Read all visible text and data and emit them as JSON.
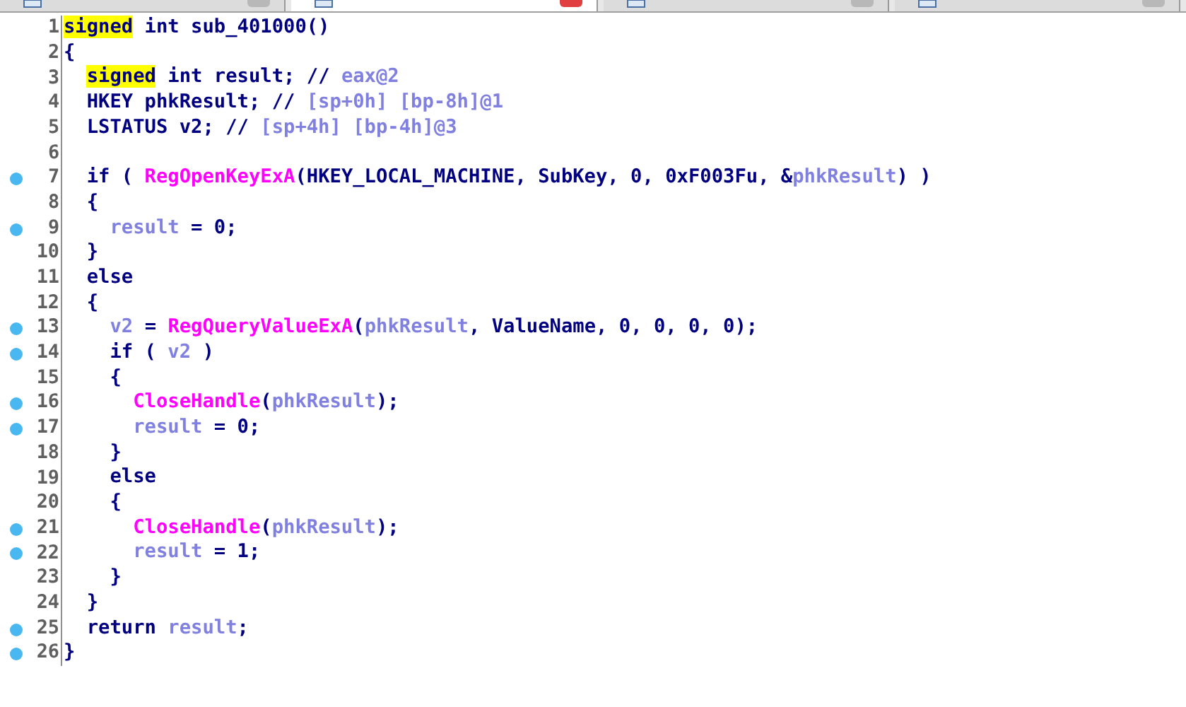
{
  "tabs": [
    {
      "selected": false
    },
    {
      "selected": true
    },
    {
      "selected": false
    },
    {
      "selected": false
    }
  ],
  "lines": [
    {
      "number": "1",
      "breakpoint": false,
      "cursor": true,
      "tokens": [
        {
          "kind": "highlight",
          "text": "signed"
        },
        {
          "kind": "plain",
          "text": " int sub_401000()"
        }
      ]
    },
    {
      "number": "2",
      "breakpoint": false,
      "cursor": false,
      "tokens": [
        {
          "kind": "plain",
          "text": "{"
        }
      ]
    },
    {
      "number": "3",
      "breakpoint": false,
      "cursor": false,
      "tokens": [
        {
          "kind": "highlight",
          "text": "  signed"
        },
        {
          "kind": "plain",
          "text": " int result; // "
        },
        {
          "kind": "local",
          "text": "eax@2"
        }
      ]
    },
    {
      "number": "4",
      "breakpoint": false,
      "cursor": false,
      "tokens": [
        {
          "kind": "plain",
          "text": "  HKEY phkResult; // "
        },
        {
          "kind": "local",
          "text": "[sp+0h] [bp-8h]@1"
        }
      ]
    },
    {
      "number": "5",
      "breakpoint": false,
      "cursor": false,
      "tokens": [
        {
          "kind": "plain",
          "text": "  LSTATUS v2; // "
        },
        {
          "kind": "local",
          "text": "[sp+4h] [bp-4h]@3"
        }
      ]
    },
    {
      "number": "6",
      "breakpoint": false,
      "cursor": false
    },
    {
      "number": "7",
      "breakpoint": true,
      "cursor": false,
      "tokens": [
        {
          "kind": "plain",
          "text": "  if ( "
        },
        {
          "kind": "function",
          "text": "RegOpenKeyExA"
        },
        {
          "kind": "plain",
          "text": "(HKEY_LOCAL_MACHINE, SubKey, 0, 0xF003Fu, &"
        },
        {
          "kind": "local",
          "text": "phkResult"
        },
        {
          "kind": "plain",
          "text": ") )"
        }
      ]
    },
    {
      "number": "8",
      "breakpoint": false,
      "cursor": false,
      "tokens": [
        {
          "kind": "plain",
          "text": "  {"
        }
      ]
    },
    {
      "number": "9",
      "breakpoint": true,
      "cursor": false,
      "tokens": [
        {
          "kind": "local",
          "text": "    result"
        },
        {
          "kind": "plain",
          "text": " = 0;"
        }
      ]
    },
    {
      "number": "10",
      "breakpoint": false,
      "cursor": false,
      "tokens": [
        {
          "kind": "plain",
          "text": "  }"
        }
      ]
    },
    {
      "number": "11",
      "breakpoint": false,
      "cursor": false,
      "tokens": [
        {
          "kind": "plain",
          "text": "  else"
        }
      ]
    },
    {
      "number": "12",
      "breakpoint": false,
      "cursor": false,
      "tokens": [
        {
          "kind": "plain",
          "text": "  {"
        }
      ]
    },
    {
      "number": "13",
      "breakpoint": true,
      "cursor": false,
      "tokens": [
        {
          "kind": "local",
          "text": "    v2"
        },
        {
          "kind": "plain",
          "text": " = "
        },
        {
          "kind": "function",
          "text": "RegQueryValueExA"
        },
        {
          "kind": "plain",
          "text": "("
        },
        {
          "kind": "local",
          "text": "phkResult"
        },
        {
          "kind": "plain",
          "text": ", ValueName, 0, 0, 0, 0);"
        }
      ]
    },
    {
      "number": "14",
      "breakpoint": true,
      "cursor": false,
      "tokens": [
        {
          "kind": "plain",
          "text": "    if ( "
        },
        {
          "kind": "local",
          "text": "v2"
        },
        {
          "kind": "plain",
          "text": " )"
        }
      ]
    },
    {
      "number": "15",
      "breakpoint": false,
      "cursor": false,
      "tokens": [
        {
          "kind": "plain",
          "text": "    {"
        }
      ]
    },
    {
      "number": "16",
      "breakpoint": true,
      "cursor": false,
      "tokens": [
        {
          "kind": "function",
          "text": "      CloseHandle"
        },
        {
          "kind": "plain",
          "text": "("
        },
        {
          "kind": "local",
          "text": "phkResult"
        },
        {
          "kind": "plain",
          "text": ");"
        }
      ]
    },
    {
      "number": "17",
      "breakpoint": true,
      "cursor": false,
      "tokens": [
        {
          "kind": "local",
          "text": "      result"
        },
        {
          "kind": "plain",
          "text": " = 0;"
        }
      ]
    },
    {
      "number": "18",
      "breakpoint": false,
      "cursor": false,
      "tokens": [
        {
          "kind": "plain",
          "text": "    }"
        }
      ]
    },
    {
      "number": "19",
      "breakpoint": false,
      "cursor": false,
      "tokens": [
        {
          "kind": "plain",
          "text": "    else"
        }
      ]
    },
    {
      "number": "20",
      "breakpoint": false,
      "cursor": false,
      "tokens": [
        {
          "kind": "plain",
          "text": "    {"
        }
      ]
    },
    {
      "number": "21",
      "breakpoint": true,
      "cursor": false,
      "tokens": [
        {
          "kind": "function",
          "text": "      CloseHandle"
        },
        {
          "kind": "plain",
          "text": "("
        },
        {
          "kind": "local",
          "text": "phkResult"
        },
        {
          "kind": "plain",
          "text": ");"
        }
      ]
    },
    {
      "number": "22",
      "breakpoint": true,
      "cursor": false,
      "tokens": [
        {
          "kind": "local",
          "text": "      result"
        },
        {
          "kind": "plain",
          "text": " = 1;"
        }
      ]
    },
    {
      "number": "23",
      "breakpoint": false,
      "cursor": false,
      "tokens": [
        {
          "kind": "plain",
          "text": "    }"
        }
      ]
    },
    {
      "number": "24",
      "breakpoint": false,
      "cursor": false,
      "tokens": [
        {
          "kind": "plain",
          "text": "  }"
        }
      ]
    },
    {
      "number": "25",
      "breakpoint": true,
      "cursor": false,
      "tokens": [
        {
          "kind": "plain",
          "text": "  return "
        },
        {
          "kind": "local",
          "text": "result"
        },
        {
          "kind": "plain",
          "text": ";"
        }
      ]
    },
    {
      "number": "26",
      "breakpoint": true,
      "cursor": false,
      "tokens": [
        {
          "kind": "plain",
          "text": "}"
        }
      ]
    }
  ]
}
